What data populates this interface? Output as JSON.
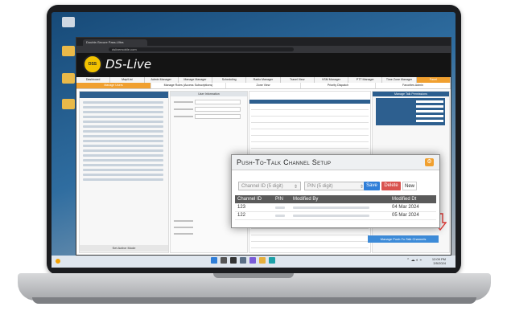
{
  "browser": {
    "tab_title": "Double-Secure Pass-Ultra",
    "url": "dslivemobile.com"
  },
  "app": {
    "logo_text": "DSS",
    "title": "DS-Live"
  },
  "nav": {
    "items": [
      "Dashboard",
      "Map/List",
      "Admin Manager",
      "Manage Manager",
      "Scheduling",
      "Radio Manager",
      "Travel View",
      "VSM Manager",
      "PTT Manager",
      "Time Zone Manager",
      "Panel"
    ]
  },
  "subnav": {
    "items": [
      "Manage Users",
      "Manage Roles (Access Subscriptions)",
      "Zone View",
      "Priority Dispatch",
      "Favorites Admin"
    ]
  },
  "left_panel": {
    "footer": "Set Active Mode"
  },
  "middle_panel": {
    "header": "User Information"
  },
  "right_panel": {
    "header": "Manage Talk Permissions",
    "green_button": "Save",
    "push_button": "Manage Push-To-Talk Channels"
  },
  "modal": {
    "title": "Push-To-Talk Channel Setup",
    "close_icon": "gear-icon",
    "channel_placeholder": "Channel ID (5 digit)",
    "pin_placeholder": "PIN (5 digit)",
    "save_label": "Save",
    "delete_label": "Delete",
    "new_label": "New",
    "columns": [
      "Channel ID",
      "PIN",
      "Modified By",
      "Modified Dt"
    ],
    "rows": [
      {
        "channel_id": "123",
        "modified_dt": "04 Mar 2024"
      },
      {
        "channel_id": "122",
        "modified_dt": "05 Mar 2024"
      }
    ]
  },
  "taskbar": {
    "time": "12:09 PM",
    "date": "3/5/2024"
  },
  "colors": {
    "accent": "#f0a030",
    "brand_blue": "#2d5f8f",
    "save": "#2f7ed8",
    "delete": "#d9534f"
  }
}
